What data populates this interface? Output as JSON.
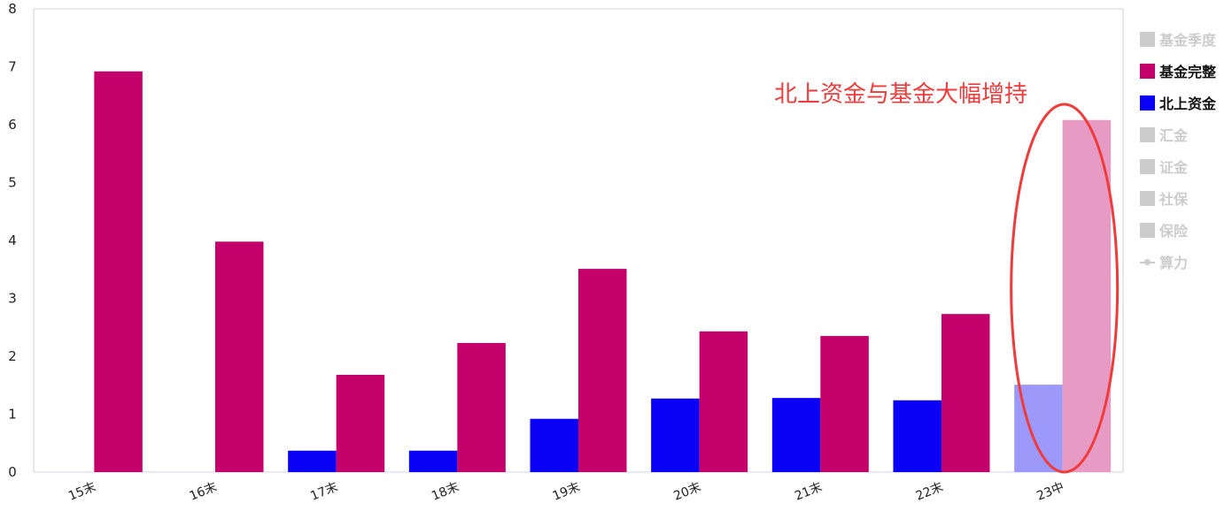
{
  "chart_data": {
    "type": "bar",
    "title": "",
    "xlabel": "",
    "ylabel": "",
    "ylim": [
      0,
      8
    ],
    "yticks": [
      "0",
      "1",
      "2",
      "3",
      "4",
      "5",
      "6",
      "7",
      "8"
    ],
    "grid": false,
    "categories": [
      "15末",
      "16末",
      "17末",
      "18末",
      "19末",
      "20末",
      "21末",
      "22末",
      "23中"
    ],
    "series": [
      {
        "name": "北上资金",
        "color": "#0a00f5",
        "highlight_color": "#9c99fb",
        "values": [
          0,
          0,
          0.37,
          0.37,
          0.92,
          1.27,
          1.28,
          1.24,
          1.51
        ]
      },
      {
        "name": "基金完整",
        "color": "#c4006a",
        "highlight_color": "#e79ac4",
        "values": [
          6.92,
          3.98,
          1.68,
          2.23,
          3.51,
          2.43,
          2.35,
          2.73,
          6.08
        ]
      }
    ],
    "highlighted_category": "23中",
    "legend": {
      "placement": "right",
      "items": [
        {
          "label": "基金季度",
          "active": false,
          "marker": "square",
          "color": "#cccccc"
        },
        {
          "label": "基金完整",
          "active": true,
          "marker": "square",
          "color": "#c4006a"
        },
        {
          "label": "北上资金",
          "active": true,
          "marker": "square",
          "color": "#0a00f5"
        },
        {
          "label": "汇金",
          "active": false,
          "marker": "square",
          "color": "#cccccc"
        },
        {
          "label": "证金",
          "active": false,
          "marker": "square",
          "color": "#cccccc"
        },
        {
          "label": "社保",
          "active": false,
          "marker": "square",
          "color": "#cccccc"
        },
        {
          "label": "保险",
          "active": false,
          "marker": "square",
          "color": "#cccccc"
        },
        {
          "label": "算力",
          "active": false,
          "marker": "line",
          "color": "#cccccc"
        }
      ]
    },
    "annotation": {
      "text": "北上资金与基金大幅增持",
      "color": "#f03b3b",
      "target": "23中"
    }
  }
}
